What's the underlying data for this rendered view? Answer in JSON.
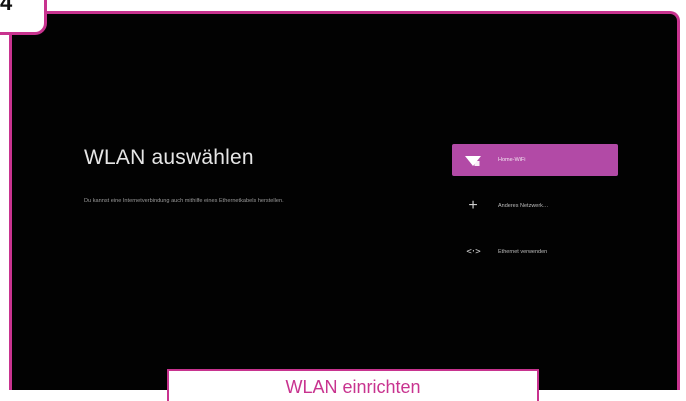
{
  "step": {
    "number": "4"
  },
  "screen": {
    "title": "WLAN auswählen",
    "subtitle": "Du kannst eine Internetverbindung auch mithilfe eines Ethernetkabels herstellen."
  },
  "networks": [
    {
      "label": "Home-WiFi",
      "icon": "wifi-icon",
      "selected": true
    },
    {
      "label": "Anderes Netzwerk…",
      "icon": "plus-icon",
      "selected": false
    },
    {
      "label": "Ethernet verwenden",
      "icon": "ethernet-icon",
      "selected": false
    }
  ],
  "caption": {
    "text": "WLAN einrichten"
  },
  "colors": {
    "accent": "#c8338f",
    "selected": "#b24aa6",
    "background": "#020202"
  }
}
